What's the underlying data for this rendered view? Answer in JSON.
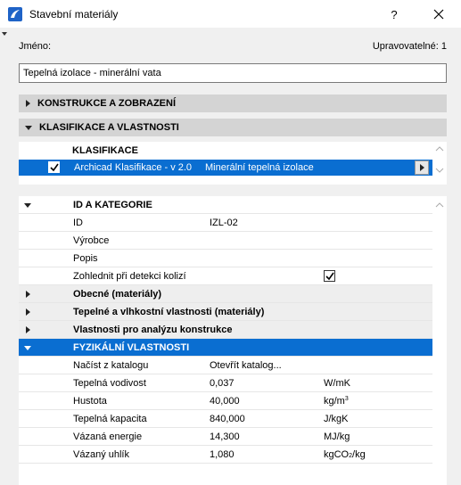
{
  "window": {
    "title": "Stavební materiály",
    "help_label": "?",
    "icons": {
      "app": "archicad-icon",
      "close": "close-icon"
    }
  },
  "header": {
    "name_label": "Jméno:",
    "editable_label": "Upravovatelné: 1",
    "name_value": "Tepelná izolace - minerální vata"
  },
  "sections": {
    "construction": "KONSTRUKCE A ZOBRAZENÍ",
    "classification": "KLASIFIKACE A VLASTNOSTI"
  },
  "classification": {
    "header": "KLASIFIKACE",
    "system": "Archicad Klasifikace - v 2.0",
    "value": "Minerální tepelná izolace",
    "checked": true
  },
  "properties": {
    "id_group": "ID A KATEGORIE",
    "id": {
      "label": "ID",
      "value": "IZL-02"
    },
    "manufacturer": {
      "label": "Výrobce"
    },
    "description": {
      "label": "Popis"
    },
    "collision": {
      "label": "Zohlednit při detekci kolizí",
      "checked": true
    },
    "groups": [
      "Obecné (materiály)",
      "Tepelné a vlhkostní vlastnosti (materiály)",
      "Vlastnosti pro analýzu konstrukce"
    ],
    "physical_group": "FYZIKÁLNÍ VLASTNOSTI",
    "catalog": {
      "label": "Načíst z katalogu",
      "value": "Otevřít katalog..."
    },
    "rows": [
      {
        "label": "Tepelná vodivost",
        "value": "0,037",
        "unit": "W/mK"
      },
      {
        "label": "Hustota",
        "value": "40,000",
        "unit_base": "kg/m",
        "unit_sup": "3"
      },
      {
        "label": "Tepelná kapacita",
        "value": "840,000",
        "unit": "J/kgK"
      },
      {
        "label": "Vázaná energie",
        "value": "14,300",
        "unit": "MJ/kg"
      },
      {
        "label": "Vázaný uhlík",
        "value": "1,080",
        "unit_base": "kgCO",
        "unit_sub": "2",
        "unit_tail": "/kg"
      }
    ]
  }
}
